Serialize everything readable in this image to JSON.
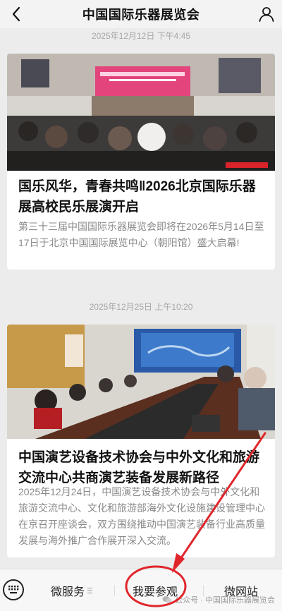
{
  "header": {
    "title": "中国国际乐器展览会"
  },
  "feed": [
    {
      "timestamp": "2025年12月12日 下午4:45",
      "title": "国乐风华，青春共鸣‖2026北京国际乐器展高校民乐展演开启",
      "summary": "第三十三届中国国际乐器展览会即将在2026年5月14日至17日于北京中国国际展览中心（朝阳馆）盛大启幕!",
      "photo_icon": "stage-performance-photo"
    },
    {
      "timestamp": "2025年12月25日 上午10:20",
      "title": "中国演艺设备技术协会与中外文化和旅游交流中心共商演艺装备发展新路径",
      "summary": "2025年12月24日，中国演艺设备技术协会与中外文化和旅游交流中心、文化和旅游部海外文化设施建设管理中心在京召开座谈会，双方围绕推动中国演艺装备行业高质量发展与海外推广合作展开深入交流。",
      "photo_icon": "meeting-room-photo"
    }
  ],
  "menu": {
    "keyboard_icon": "keyboard-icon",
    "items": [
      {
        "label": "微服务"
      },
      {
        "label": "我要参观"
      },
      {
        "label": "微网站"
      }
    ]
  },
  "watermark": "公众号 · 中国国际乐器展览会",
  "colors": {
    "annotation": "#e0262b",
    "background": "#ececec",
    "card": "#ffffff",
    "muted_text": "#8a8a8a"
  }
}
